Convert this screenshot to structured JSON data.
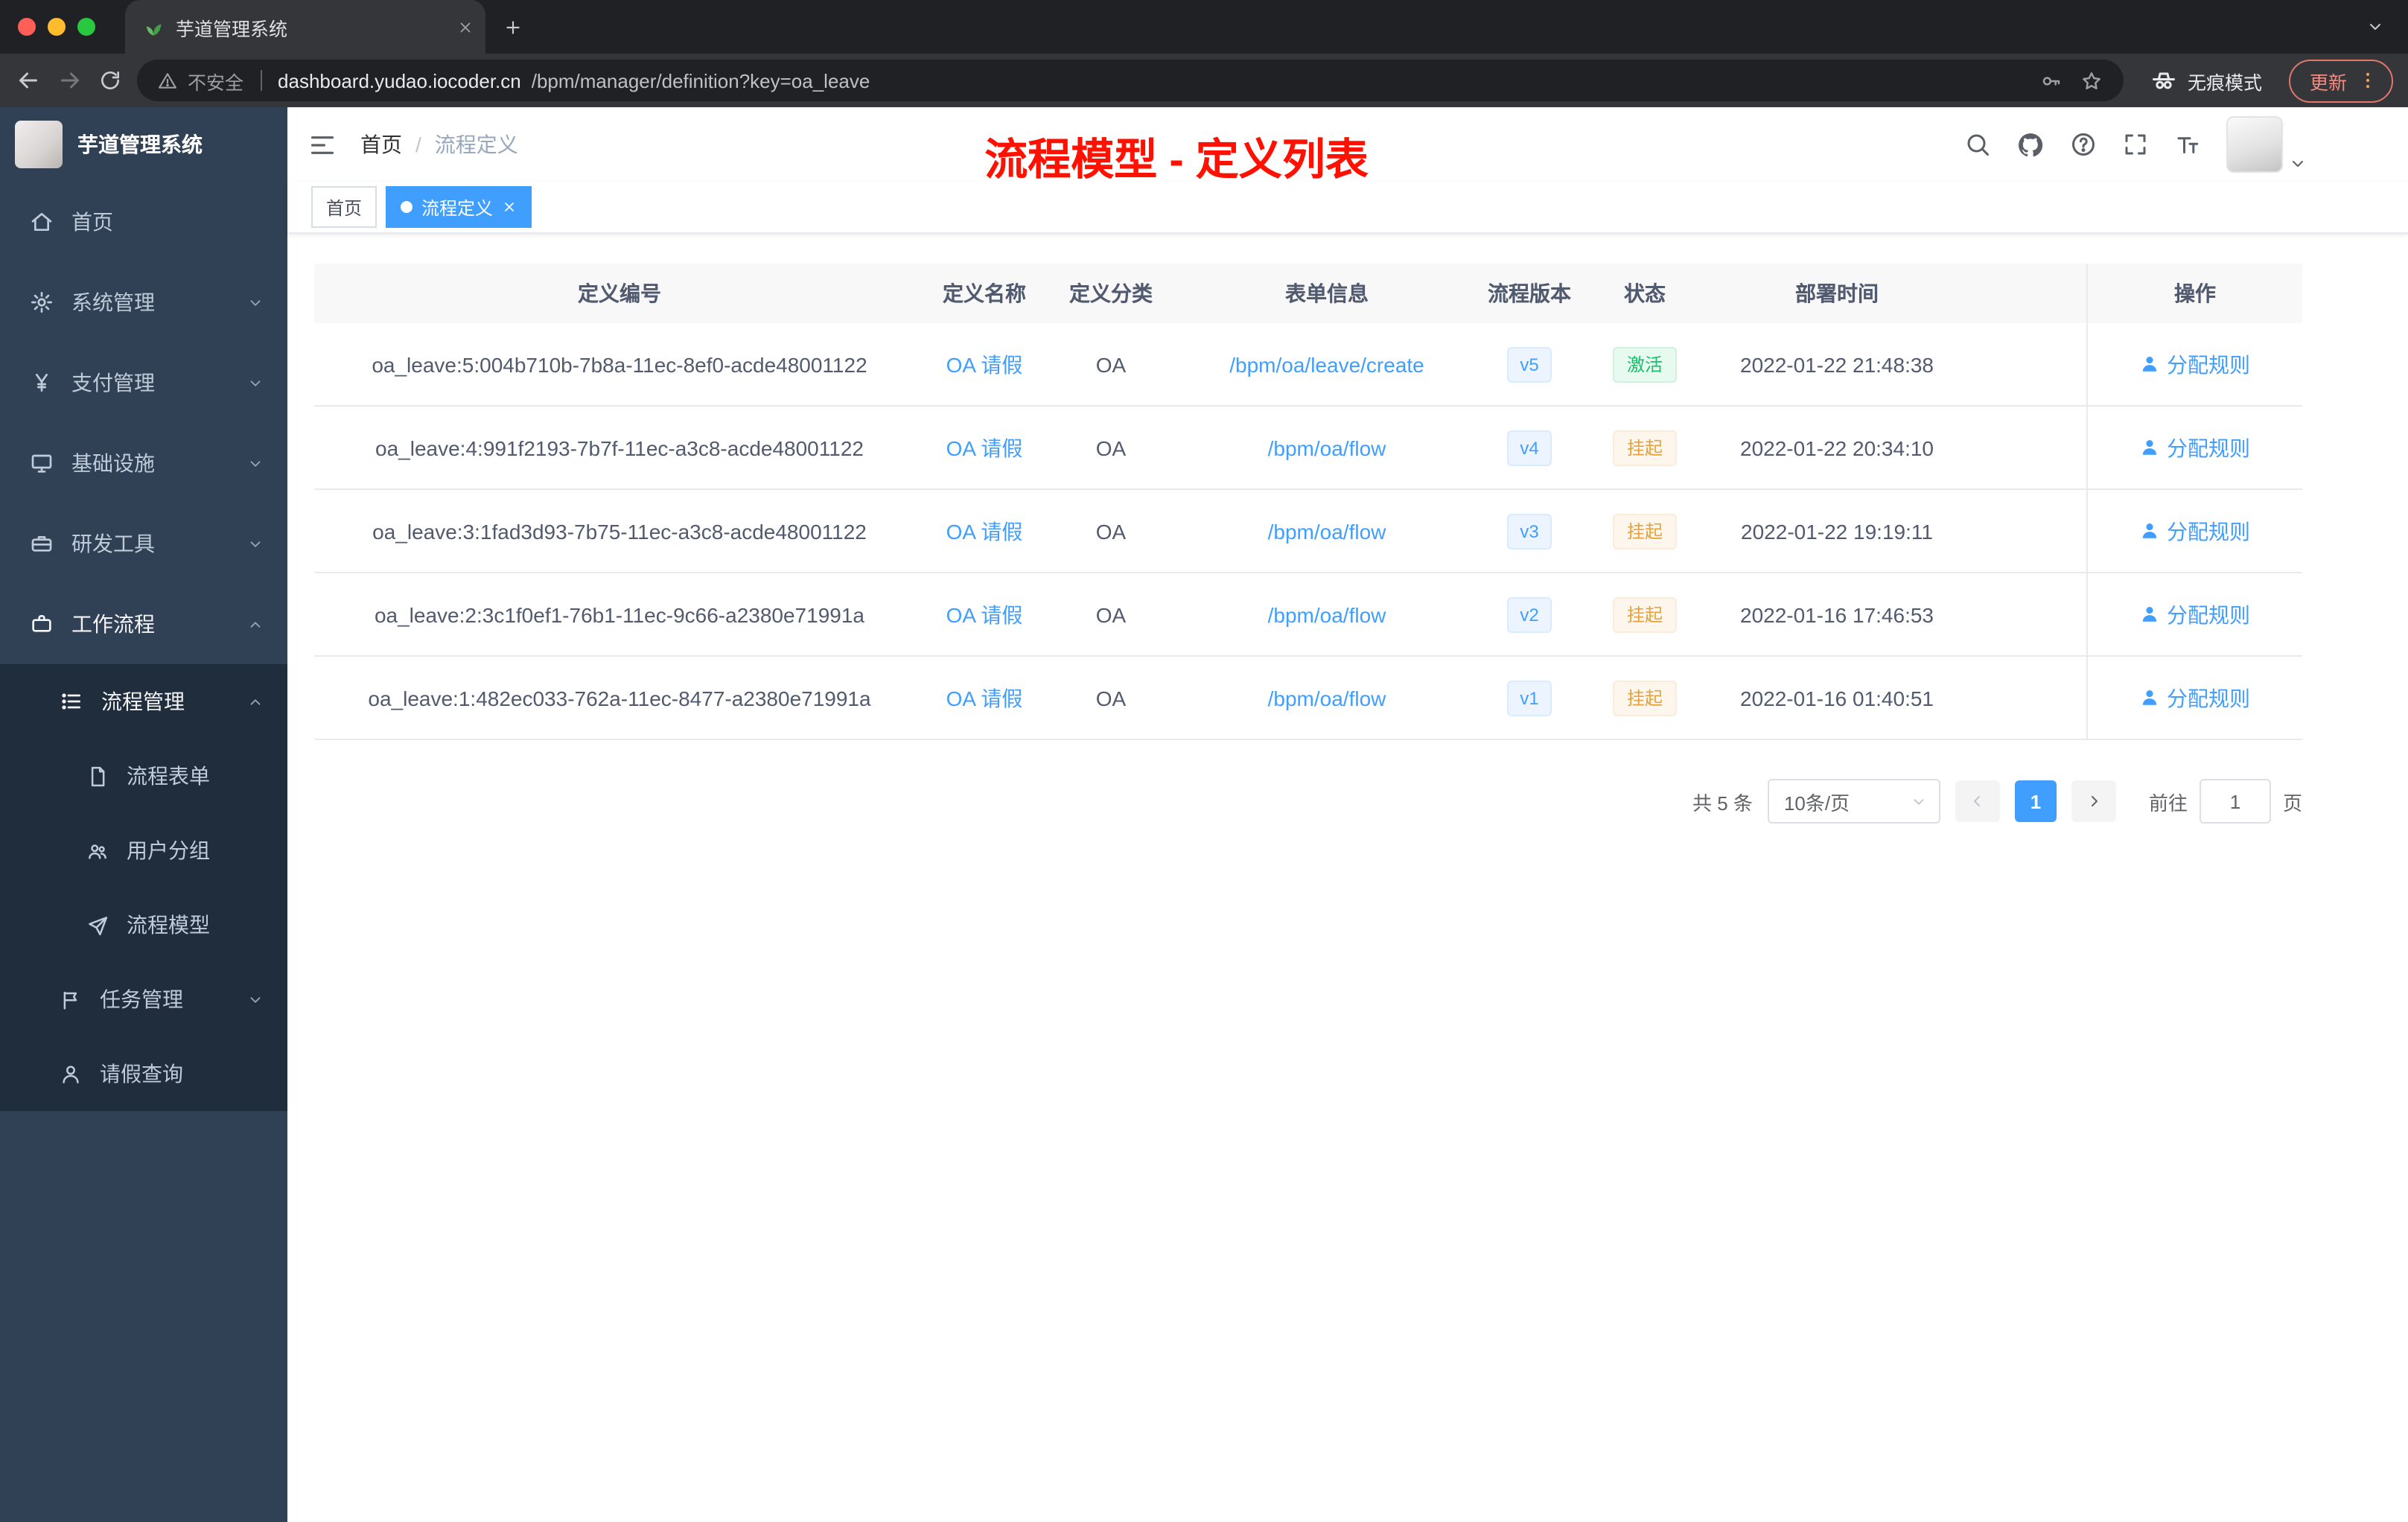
{
  "colors": {
    "accent": "#409eff",
    "success_text": "#19be6b",
    "warning_text": "#e6a23c",
    "annotation_red": "#fe1100",
    "sidebar_bg": "#304156",
    "submenu_bg": "#1f2d3d"
  },
  "browser": {
    "tab": {
      "title": "芋道管理系统"
    },
    "address": {
      "security_label": "不安全",
      "host": "dashboard.yudao.iocoder.cn",
      "path": "/bpm/manager/definition?key=oa_leave"
    },
    "incognito_label": "无痕模式",
    "update_label": "更新"
  },
  "sidebar": {
    "app_title": "芋道管理系统",
    "menu": [
      {
        "label": "首页"
      },
      {
        "label": "系统管理"
      },
      {
        "label": "支付管理"
      },
      {
        "label": "基础设施"
      },
      {
        "label": "研发工具"
      },
      {
        "label": "工作流程"
      },
      {
        "label": "流程管理"
      },
      {
        "label": "流程表单"
      },
      {
        "label": "用户分组"
      },
      {
        "label": "流程模型"
      },
      {
        "label": "任务管理"
      },
      {
        "label": "请假查询"
      }
    ]
  },
  "topbar": {
    "breadcrumb": [
      "首页",
      "流程定义"
    ],
    "separator": "/"
  },
  "annotation": {
    "title": "流程模型 - 定义列表"
  },
  "tags": [
    {
      "label": "首页"
    },
    {
      "label": "流程定义"
    }
  ],
  "table": {
    "columns": [
      "定义编号",
      "定义名称",
      "定义分类",
      "表单信息",
      "流程版本",
      "状态",
      "部署时间",
      "操作"
    ],
    "rows": [
      {
        "id": "oa_leave:5:004b710b-7b8a-11ec-8ef0-acde48001122",
        "name": "OA 请假",
        "category": "OA",
        "form": "/bpm/oa/leave/create",
        "version": "v5",
        "status": "激活",
        "time": "2022-01-22 21:48:38",
        "action": "分配规则"
      },
      {
        "id": "oa_leave:4:991f2193-7b7f-11ec-a3c8-acde48001122",
        "name": "OA 请假",
        "category": "OA",
        "form": "/bpm/oa/flow",
        "version": "v4",
        "status": "挂起",
        "time": "2022-01-22 20:34:10",
        "action": "分配规则"
      },
      {
        "id": "oa_leave:3:1fad3d93-7b75-11ec-a3c8-acde48001122",
        "name": "OA 请假",
        "category": "OA",
        "form": "/bpm/oa/flow",
        "version": "v3",
        "status": "挂起",
        "time": "2022-01-22 19:19:11",
        "action": "分配规则"
      },
      {
        "id": "oa_leave:2:3c1f0ef1-76b1-11ec-9c66-a2380e71991a",
        "name": "OA 请假",
        "category": "OA",
        "form": "/bpm/oa/flow",
        "version": "v2",
        "status": "挂起",
        "time": "2022-01-16 17:46:53",
        "action": "分配规则"
      },
      {
        "id": "oa_leave:1:482ec033-762a-11ec-8477-a2380e71991a",
        "name": "OA 请假",
        "category": "OA",
        "form": "/bpm/oa/flow",
        "version": "v1",
        "status": "挂起",
        "time": "2022-01-16 01:40:51",
        "action": "分配规则"
      }
    ]
  },
  "pagination": {
    "total": "共 5 条",
    "page_size": "10条/页",
    "page": "1",
    "goto": "前往",
    "unit": "页",
    "goto_value": "1"
  }
}
